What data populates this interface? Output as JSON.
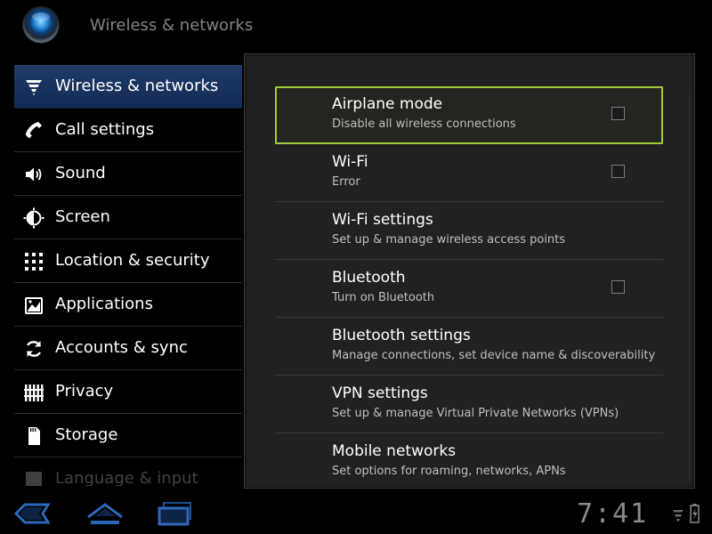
{
  "action_bar": {
    "title": "Wireless & networks",
    "app_icon": "settings-app-icon"
  },
  "nav": {
    "items": [
      {
        "label": "Wireless & networks",
        "icon": "wifi-signal-icon",
        "selected": true
      },
      {
        "label": "Call settings",
        "icon": "phone-icon"
      },
      {
        "label": "Sound",
        "icon": "speaker-icon"
      },
      {
        "label": "Screen",
        "icon": "brightness-icon"
      },
      {
        "label": "Location & security",
        "icon": "location-grid-icon"
      },
      {
        "label": "Applications",
        "icon": "applications-icon"
      },
      {
        "label": "Accounts & sync",
        "icon": "sync-icon"
      },
      {
        "label": "Privacy",
        "icon": "privacy-icon"
      },
      {
        "label": "Storage",
        "icon": "sdcard-icon"
      },
      {
        "label": "Language & input",
        "icon": "language-icon",
        "partially_visible": true
      }
    ]
  },
  "preferences": [
    {
      "title": "Airplane mode",
      "summary": "Disable all wireless connections",
      "checkbox": true,
      "checked": false,
      "focused": true
    },
    {
      "title": "Wi-Fi",
      "summary": "Error",
      "checkbox": true,
      "checked": false
    },
    {
      "title": "Wi-Fi settings",
      "summary": "Set up & manage wireless access points",
      "checkbox": false
    },
    {
      "title": "Bluetooth",
      "summary": "Turn on Bluetooth",
      "checkbox": true,
      "checked": false
    },
    {
      "title": "Bluetooth settings",
      "summary": "Manage connections, set device name & discoverability",
      "checkbox": false
    },
    {
      "title": "VPN settings",
      "summary": "Set up & manage Virtual Private Networks (VPNs)",
      "checkbox": false
    },
    {
      "title": "Mobile networks",
      "summary": "Set options for roaming, networks, APNs",
      "checkbox": false
    }
  ],
  "system_bar": {
    "clock": "7:41",
    "buttons": [
      "back-icon",
      "home-icon",
      "recent-apps-icon"
    ],
    "status": [
      "no-signal-icon",
      "battery-charging-icon"
    ]
  },
  "colors": {
    "accent": "#9ccc3c",
    "selected_nav": "#1a3560",
    "panel": "#212121"
  }
}
